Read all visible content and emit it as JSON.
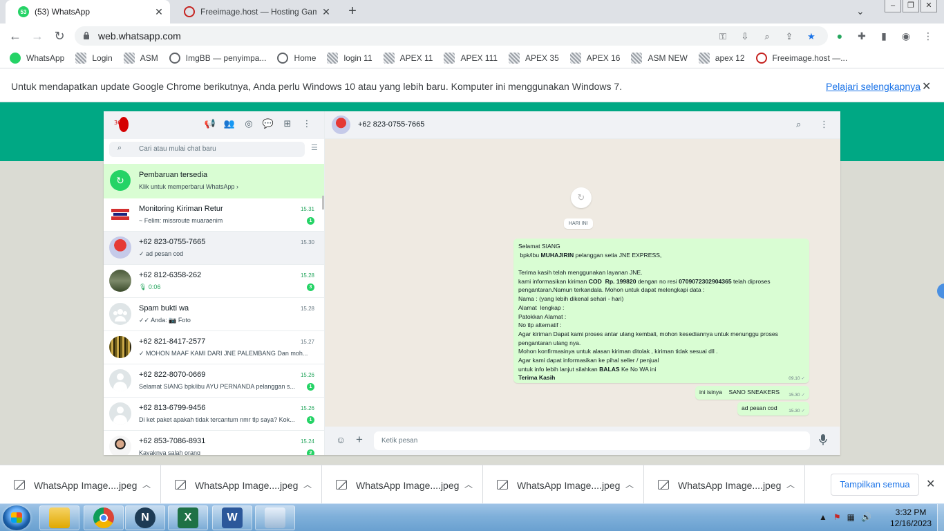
{
  "browser": {
    "tabs": [
      {
        "title": "(53) WhatsApp",
        "badge": "53",
        "active": true
      },
      {
        "title": "Freeimage.host — Hosting Gamb",
        "active": false
      }
    ],
    "new_tab": "+",
    "url": "web.whatsapp.com",
    "bookmarks": [
      "WhatsApp",
      "Login",
      "ASM",
      "ImgBB — penyimpa...",
      "Home",
      "login 11",
      "APEX 11",
      "APEX 111",
      "APEX 35",
      "APEX 16",
      "ASM  NEW",
      "apex 12",
      "Freeimage.host —..."
    ],
    "infobar": {
      "message": "Untuk mendapatkan update Google Chrome berikutnya, Anda perlu Windows 10 atau yang lebih baru. Komputer ini menggunakan Windows 7.",
      "link": "Pelajari selengkapnya"
    }
  },
  "whatsapp": {
    "search_placeholder": "Cari atau mulai chat baru",
    "update_banner": {
      "title": "Pembaruan tersedia",
      "subtitle": "Klik untuk memperbarui WhatsApp ›"
    },
    "chats": [
      {
        "name": "Monitoring Kiriman Retur",
        "time": "15.31",
        "preview": "~ Felim: missroute muaraenim",
        "unread": "1"
      },
      {
        "name": "+62 823-0755-7665",
        "time": "15.30",
        "preview": "✓ ad pesan cod",
        "unread": ""
      },
      {
        "name": "+62 812-6358-262",
        "time": "15.28",
        "preview": "🎙 0:06",
        "unread": "3"
      },
      {
        "name": "Spam bukti wa",
        "time": "15.28",
        "preview": "✓✓ Anda: 📷 Foto",
        "unread": ""
      },
      {
        "name": "+62 821-8417-2577",
        "time": "15.27",
        "preview": "✓ MOHON MAAF KAMI DARI JNE PALEMBANG   Dan moh...",
        "unread": ""
      },
      {
        "name": "+62 822-8070-0669",
        "time": "15.26",
        "preview": "Selamat SIANG  bpk/ibu AYU PERNANDA pelanggan s...",
        "unread": "1"
      },
      {
        "name": "+62 813-6799-9456",
        "time": "15.26",
        "preview": "Di ket paket apakah tidak tercantum nmr tlp saya? Kok...",
        "unread": "1"
      },
      {
        "name": "+62 853-7086-8931",
        "time": "15.24",
        "preview": "Kayaknya salah orang",
        "unread": "2"
      }
    ],
    "conversation": {
      "contact": "+62 823-0755-7665",
      "day_chip": "HARI INI",
      "big_message": {
        "lines": [
          "Selamat SIANG",
          " bpk/ibu MUHAJIRIN pelanggan setia JNE EXPRESS,",
          "",
          "Terima kasih telah menggunakan layanan JNE.",
          "kami informasikan kiriman COD  Rp. 199820 dengan no resi 0709072302904365 telah diproses",
          "pengantaran.Namun terkandala. Mohon untuk dapat melengkapi data :",
          "Nama : (yang lebih dikenal sehari - hari)",
          "Alamat  lengkap :",
          "Patokkan Alamat :",
          "No tlp alternatif :",
          "Agar kiriman Dapat kami proses antar ulang kembali, mohon kesediannya untuk menunggu proses",
          "pengantaran ulang nya.",
          "Mohon konfirmasinya untuk alasan kiriman ditolak , kiriman tidak sesuai dll .",
          "Agar kami dapat informasikan ke pihal seller / penjual",
          "untuk info lebih lanjut silahkan BALAS Ke No WA ini",
          "Terima Kasih"
        ],
        "time": "09.10"
      },
      "small_messages": [
        {
          "text": "ini isinya    SANO SNEAKERS",
          "time": "15.30"
        },
        {
          "text": "ad pesan cod",
          "time": "15.30"
        }
      ],
      "composer_placeholder": "Ketik pesan"
    }
  },
  "downloads": {
    "items": [
      "WhatsApp Image....jpeg",
      "WhatsApp Image....jpeg",
      "WhatsApp Image....jpeg",
      "WhatsApp Image....jpeg",
      "WhatsApp Image....jpeg"
    ],
    "show_all": "Tampilkan semua"
  },
  "taskbar": {
    "time": "3:32 PM",
    "date": "12/16/2023"
  }
}
